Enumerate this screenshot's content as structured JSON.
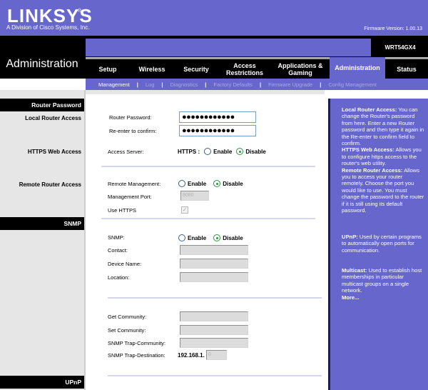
{
  "brand": {
    "logo": "LINKSYS",
    "registered": "®",
    "subtitle": "A Division of Cisco Systems, Inc.",
    "firmware": "Firmware Version: 1.00.13"
  },
  "header": {
    "section_title": "Administration",
    "model": "WRT54GX4"
  },
  "tabs": [
    {
      "label": "Setup",
      "active": false
    },
    {
      "label": "Wireless",
      "active": false
    },
    {
      "label": "Security",
      "active": false
    },
    {
      "label": "Access Restrictions",
      "active": false
    },
    {
      "label": "Applications & Gaming",
      "active": false
    },
    {
      "label": "Administration",
      "active": true
    },
    {
      "label": "Status",
      "active": false
    }
  ],
  "subnav": {
    "items": [
      "Management",
      "Log",
      "Diagnostics",
      "Factory Defaults",
      "Firmware Upgrade",
      "Config Management"
    ],
    "separator": "|",
    "active": "Management"
  },
  "left": {
    "router_password_header": "Router Password",
    "local_router_access": "Local Router Access",
    "https_web_access": "HTTPS Web Access",
    "remote_router_access": "Remote Router Access",
    "snmp_header": "SNMP",
    "upnp_header": "UPnP"
  },
  "form": {
    "router_password_label": "Router Password:",
    "router_password_value": "●●●●●●●●●●●●",
    "reenter_label": "Re-enter to confirm:",
    "reenter_value": "●●●●●●●●●●●●",
    "access_server_label": "Access Server:",
    "https_label": "HTTPS :",
    "https_enable": "Enable",
    "https_disable": "Disable",
    "https_selected": "Disable",
    "remote_mgmt_label": "Remote Management:",
    "remote_enable": "Enable",
    "remote_disable": "Disable",
    "remote_selected": "Disable",
    "mgmt_port_label": "Management Port:",
    "mgmt_port_value": "8080",
    "use_https_label": "Use HTTPS",
    "use_https_checked": true,
    "snmp_label": "SNMP:",
    "snmp_enable": "Enable",
    "snmp_disable": "Disable",
    "snmp_selected": "Disable",
    "contact_label": "Contact:",
    "contact_value": "",
    "device_name_label": "Device Name:",
    "device_name_value": "",
    "location_label": "Location:",
    "location_value": "",
    "get_community_label": "Get Community:",
    "get_community_value": "",
    "set_community_label": "Set Community:",
    "set_community_value": "",
    "trap_community_label": "SNMP Trap-Community:",
    "trap_community_value": "",
    "trap_destination_label": "SNMP Trap-Destination:",
    "trap_destination_prefix": "192.168.1.",
    "trap_destination_value": "0"
  },
  "help": {
    "local_title": "Local Router Access:",
    "local_text": " You can change the Router's password from here. Enter a new Router password and then type it again in the Re-enter to confirm field to confirm.",
    "https_title": "HTTPS Web Access:",
    "https_text": " Allows you to configure https access to the router's web utility.",
    "remote_title": "Remote Router Access:",
    "remote_text": " Allows you to access your router remotely. Choose the port you would like to use. You must change the password to the router if it is still using its default password.",
    "upnp_title": "UPnP:",
    "upnp_text": " Used by certain programs to automatically open ports for communication.",
    "multicast_title": "Multicast:",
    "multicast_text": " Used to establish host memberships in particular multicast groups on a single network.",
    "more_link": "More..."
  }
}
